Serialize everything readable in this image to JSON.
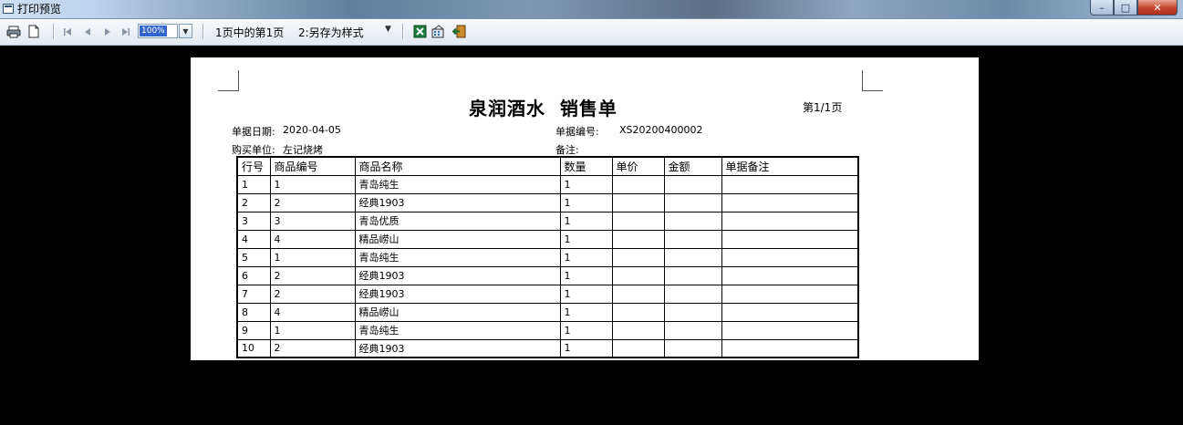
{
  "window": {
    "title": "打印预览",
    "controls": {
      "minimize": "–",
      "maximize": "□",
      "close": "✕"
    }
  },
  "toolbar": {
    "zoom": "100%",
    "page_info": "1页中的第1页",
    "style_select": "2:另存为样式",
    "icons": [
      "print-icon",
      "page-setup-icon",
      "first-page-icon",
      "prev-page-icon",
      "next-page-icon",
      "last-page-icon",
      "excel-export-icon",
      "settings-icon",
      "exit-icon"
    ]
  },
  "document": {
    "title": "泉润酒水  销售单",
    "page_no": "第1/1页",
    "date_label": "单据日期:",
    "date_value": "2020-04-05",
    "number_label": "单据编号:",
    "number_value": "XS20200400002",
    "buyer_label": "购买单位:",
    "buyer_value": "左记烧烤",
    "note_label": "备注:",
    "columns": [
      "行号",
      "商品编号",
      "商品名称",
      "数量",
      "单价",
      "金额",
      "单据备注"
    ],
    "rows": [
      [
        "1",
        "1",
        "青岛纯生",
        "1",
        "",
        "",
        ""
      ],
      [
        "2",
        "2",
        "经典1903",
        "1",
        "",
        "",
        ""
      ],
      [
        "3",
        "3",
        "青岛优质",
        "1",
        "",
        "",
        ""
      ],
      [
        "4",
        "4",
        "精品崂山",
        "1",
        "",
        "",
        ""
      ],
      [
        "5",
        "1",
        "青岛纯生",
        "1",
        "",
        "",
        ""
      ],
      [
        "6",
        "2",
        "经典1903",
        "1",
        "",
        "",
        ""
      ],
      [
        "7",
        "2",
        "经典1903",
        "1",
        "",
        "",
        ""
      ],
      [
        "8",
        "4",
        "精品崂山",
        "1",
        "",
        "",
        ""
      ],
      [
        "9",
        "1",
        "青岛纯生",
        "1",
        "",
        "",
        ""
      ],
      [
        "10",
        "2",
        "经典1903",
        "1",
        "",
        "",
        ""
      ]
    ]
  },
  "colors": {
    "background": "#000000",
    "page": "#ffffff",
    "zoom_highlight": "#3366cc"
  }
}
